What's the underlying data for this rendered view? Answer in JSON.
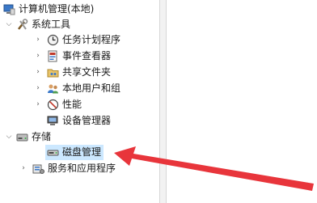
{
  "tree": {
    "root": {
      "label": "计算机管理(本地)",
      "icon": "computer-management-icon"
    },
    "system_tools": {
      "label": "系统工具",
      "icon": "tools-icon",
      "expanded": true,
      "children": [
        {
          "label": "任务计划程序",
          "icon": "clock-icon"
        },
        {
          "label": "事件查看器",
          "icon": "event-viewer-icon"
        },
        {
          "label": "共享文件夹",
          "icon": "shared-folder-icon"
        },
        {
          "label": "本地用户和组",
          "icon": "users-icon"
        },
        {
          "label": "性能",
          "icon": "performance-icon"
        },
        {
          "label": "设备管理器",
          "icon": "device-manager-icon"
        }
      ]
    },
    "storage": {
      "label": "存储",
      "icon": "storage-icon",
      "expanded": true,
      "children": [
        {
          "label": "磁盘管理",
          "icon": "disk-icon",
          "selected": true
        }
      ]
    },
    "services": {
      "label": "服务和应用程序",
      "icon": "services-icon",
      "expanded": false
    }
  },
  "colors": {
    "selection": "#cce8ff",
    "arrow": "#e8353b"
  }
}
